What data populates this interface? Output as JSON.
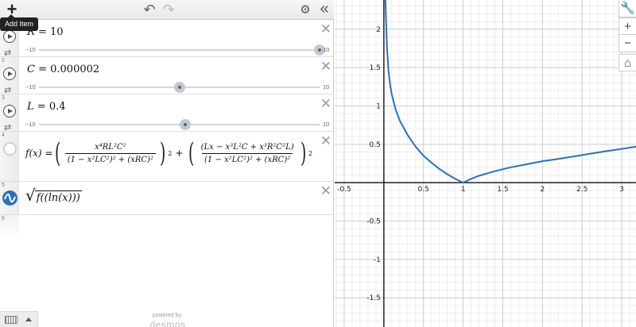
{
  "toolbar": {
    "add_label": "+",
    "tooltip": "Add Item",
    "undo_icon": "↶",
    "redo_icon": "↷",
    "settings_icon": "⚙",
    "collapse_icon": "«"
  },
  "expressions": [
    {
      "index": "1",
      "var": "R",
      "value": "10",
      "slider": {
        "min": "−10",
        "max": "10",
        "value": 10,
        "lo": -10,
        "hi": 10
      }
    },
    {
      "index": "2",
      "var": "C",
      "value": "0.000002",
      "slider": {
        "min": "−10",
        "max": "10",
        "value": 2e-06,
        "lo": -10,
        "hi": 10
      }
    },
    {
      "index": "3",
      "var": "L",
      "value": "0.4",
      "slider": {
        "min": "−10",
        "max": "10",
        "value": 0.4,
        "lo": -10,
        "hi": 10
      }
    },
    {
      "index": "4"
    },
    {
      "index": "5"
    },
    {
      "index": "6"
    }
  ],
  "formula": {
    "lhs": "f(x) =",
    "term1_num": "x⁴RL²C²",
    "term1_den": "(1 − x²LC²)² + (xRC)²",
    "term2_num": "(Lx − x³L²C + x³R²C²L)",
    "term2_den": "(1 − x²LC²)² + (xRC)²",
    "exp": "2",
    "plus": "+"
  },
  "sqrt_expr": "f((ln(x)))",
  "footer": {
    "powered": "powered by",
    "brand": "desmos"
  },
  "graph_tools": {
    "wrench_icon": "🔧",
    "zoom_in": "+",
    "zoom_out": "−",
    "home_icon": "⌂"
  },
  "chart_data": {
    "type": "line",
    "xlim": [
      -0.62,
      3.18
    ],
    "ylim": [
      -1.88,
      2.38
    ],
    "x_ticks": [
      "-0.5",
      "0.5",
      "1",
      "1.5",
      "2",
      "2.5",
      "3"
    ],
    "y_ticks": [
      "2",
      "1.5",
      "1",
      "0.5",
      "-0.5",
      "-1",
      "-1.5"
    ],
    "grid": true,
    "curve_color": "#2d70b3",
    "points": [
      [
        0.02,
        2.38
      ],
      [
        0.04,
        1.75
      ],
      [
        0.06,
        1.45
      ],
      [
        0.08,
        1.27
      ],
      [
        0.1,
        1.15
      ],
      [
        0.15,
        0.95
      ],
      [
        0.2,
        0.81
      ],
      [
        0.3,
        0.62
      ],
      [
        0.4,
        0.47
      ],
      [
        0.5,
        0.35
      ],
      [
        0.6,
        0.26
      ],
      [
        0.7,
        0.18
      ],
      [
        0.8,
        0.11
      ],
      [
        0.9,
        0.05
      ],
      [
        1.0,
        0.0
      ],
      [
        1.1,
        0.05
      ],
      [
        1.2,
        0.09
      ],
      [
        1.4,
        0.15
      ],
      [
        1.6,
        0.2
      ],
      [
        1.8,
        0.24
      ],
      [
        2.0,
        0.28
      ],
      [
        2.2,
        0.31
      ],
      [
        2.5,
        0.36
      ],
      [
        2.8,
        0.41
      ],
      [
        3.0,
        0.44
      ],
      [
        3.18,
        0.47
      ]
    ]
  }
}
